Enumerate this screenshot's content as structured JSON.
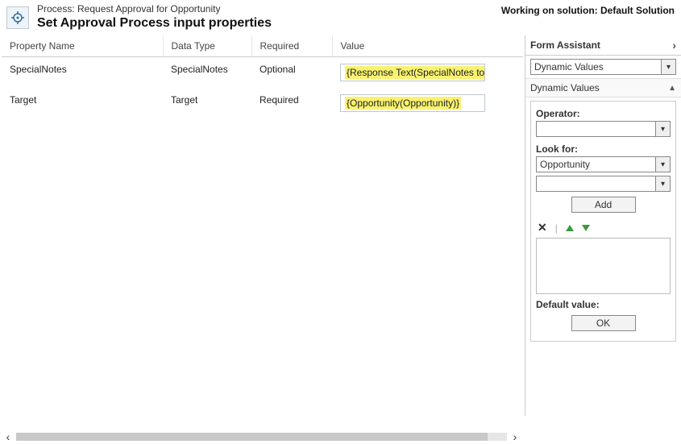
{
  "header": {
    "process_prefix": "Process: ",
    "process_name": "Request Approval for Opportunity",
    "title": "Set Approval Process input properties",
    "working_on_prefix": "Working on solution: ",
    "working_on_solution": "Default Solution"
  },
  "columns": {
    "name": "Property Name",
    "dtype": "Data Type",
    "required": "Required",
    "value": "Value"
  },
  "rows": [
    {
      "name": "SpecialNotes",
      "dtype": "SpecialNotes",
      "required": "Optional",
      "value_display": "{Response Text(SpecialNotes to Manage"
    },
    {
      "name": "Target",
      "dtype": "Target",
      "required": "Required",
      "value_display": "{Opportunity(Opportunity)}"
    }
  ],
  "form_assistant": {
    "title": "Form Assistant",
    "top_select": "Dynamic Values",
    "section_title": "Dynamic Values",
    "operator_label": "Operator:",
    "operator_value": "",
    "look_for_label": "Look for:",
    "look_for_value": "Opportunity",
    "look_for_sub_value": "",
    "add_label": "Add",
    "default_label": "Default value:",
    "ok_label": "OK"
  }
}
